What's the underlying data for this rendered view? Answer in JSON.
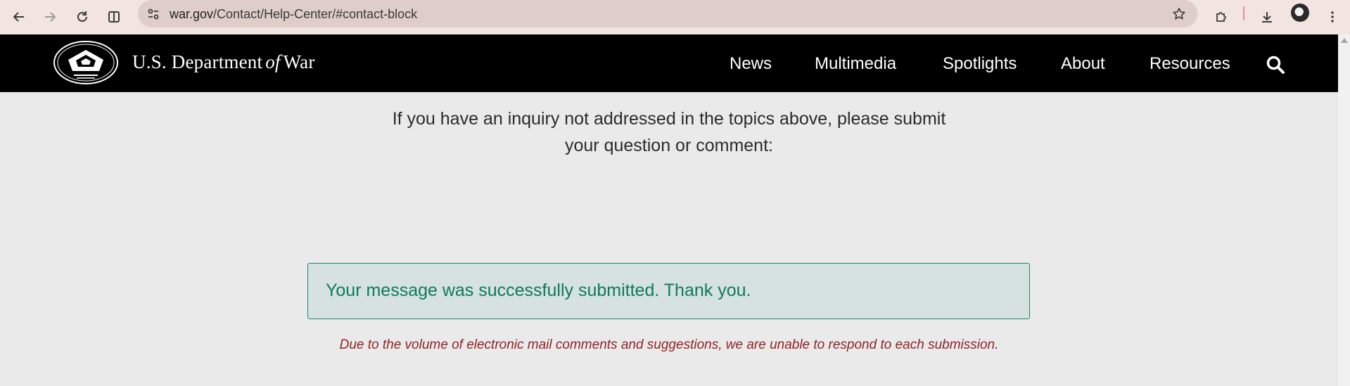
{
  "browser": {
    "url_domain": "war.gov",
    "url_path": "/Contact/Help-Center/#contact-block"
  },
  "header": {
    "title_prefix": "U.S. Department",
    "title_of": "of",
    "title_suffix": "War",
    "nav": [
      "News",
      "Multimedia",
      "Spotlights",
      "About",
      "Resources"
    ]
  },
  "content": {
    "intro_line1": "If you have an inquiry not addressed in the topics above, please submit",
    "intro_line2": "your question or comment:",
    "success_message": "Your message was successfully submitted. Thank you.",
    "disclaimer": "Due to the volume of electronic mail comments and suggestions, we are unable to respond to each submission."
  },
  "colors": {
    "header_bg": "#000000",
    "success_text": "#0f7b57",
    "disclaimer_text": "#8f2424"
  }
}
